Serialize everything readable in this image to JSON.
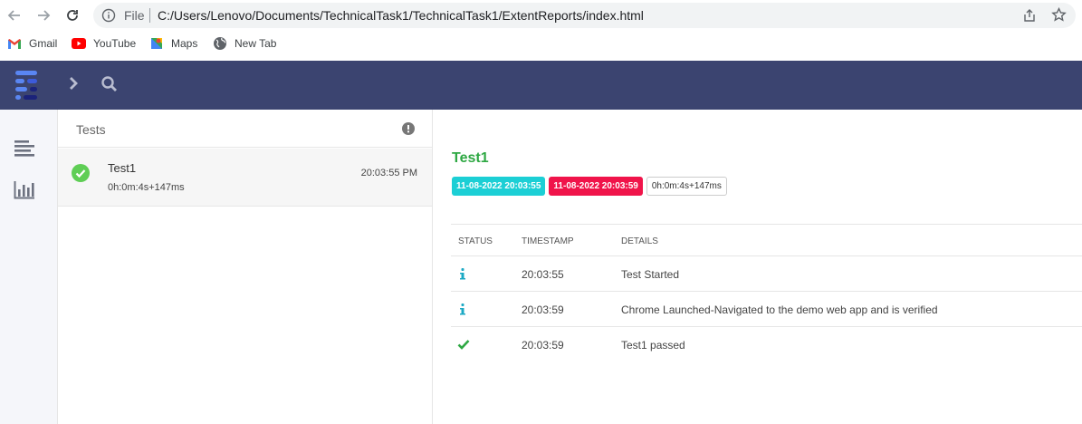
{
  "browser": {
    "file_label": "File",
    "url": "C:/Users/Lenovo/Documents/TechnicalTask1/TechnicalTask1/ExtentReports/index.html",
    "bookmarks": [
      {
        "label": "Gmail",
        "icon": "gmail-icon"
      },
      {
        "label": "YouTube",
        "icon": "youtube-icon"
      },
      {
        "label": "Maps",
        "icon": "maps-icon"
      },
      {
        "label": "New Tab",
        "icon": "globe-icon"
      }
    ]
  },
  "colors": {
    "header_bg": "#3b4470",
    "pass_green": "#2ea843",
    "start_badge": "#1ccfd5",
    "end_badge": "#f0144a",
    "info_blue": "#1ba9c4"
  },
  "test_list": {
    "title": "Tests",
    "items": [
      {
        "name": "Test1",
        "duration": "0h:0m:4s+147ms",
        "time": "20:03:55 PM",
        "status": "pass"
      }
    ]
  },
  "detail": {
    "title": "Test1",
    "start": "11-08-2022 20:03:55",
    "end": "11-08-2022 20:03:59",
    "duration": "0h:0m:4s+147ms",
    "columns": {
      "status": "STATUS",
      "timestamp": "TIMESTAMP",
      "details": "DETAILS"
    },
    "logs": [
      {
        "status": "info",
        "timestamp": "20:03:55",
        "details": "Test Started"
      },
      {
        "status": "info",
        "timestamp": "20:03:59",
        "details": "Chrome Launched-Navigated to the demo web app and is verified"
      },
      {
        "status": "pass",
        "timestamp": "20:03:59",
        "details": "Test1 passed"
      }
    ]
  }
}
